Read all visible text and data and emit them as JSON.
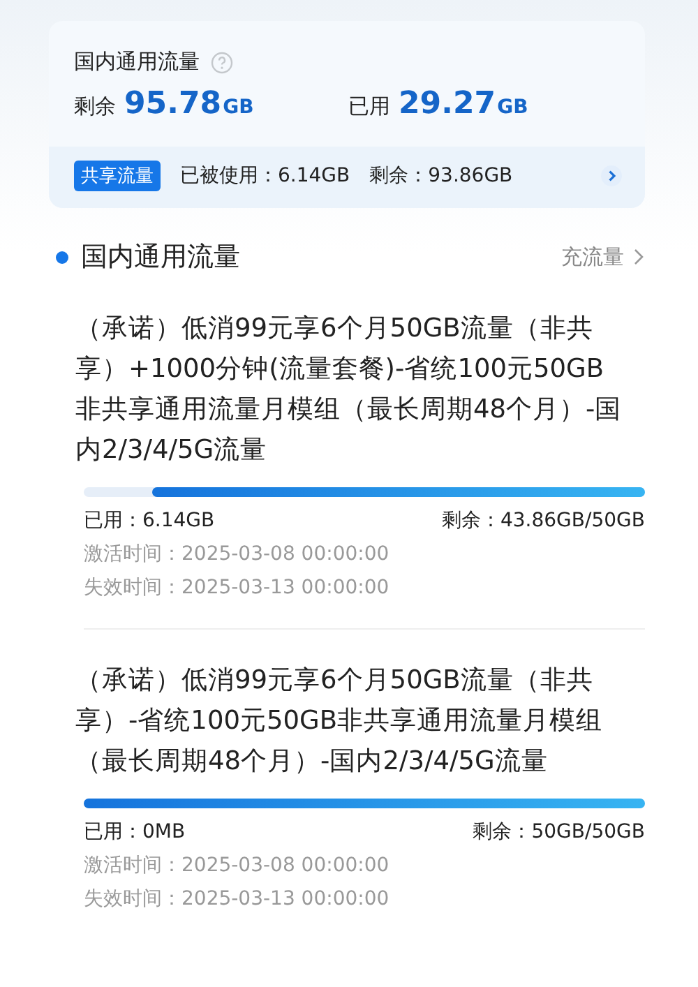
{
  "summary": {
    "title": "国内通用流量",
    "remaining_label": "剩余",
    "remaining_value": "95.78",
    "remaining_unit": "GB",
    "used_label": "已用",
    "used_value": "29.27",
    "used_unit": "GB",
    "shared": {
      "tag": "共享流量",
      "used": "已被使用：6.14GB",
      "remaining": "剩余：93.86GB"
    }
  },
  "section": {
    "title": "国内通用流量",
    "action": "充流量"
  },
  "packages": [
    {
      "name": "（承诺）低消99元享6个月50GB流量（非共享）+1000分钟(流量套餐)-省统100元50GB非共享通用流量月模组（最长周期48个月）-国内2/3/4/5G流量",
      "level": 0.877,
      "used": "已用：6.14GB",
      "remaining": "剩余：43.86GB/50GB",
      "activated": "激活时间：2025-03-08 00:00:00",
      "expires": "失效时间：2025-03-13 00:00:00"
    },
    {
      "name": "（承诺）低消99元享6个月50GB流量（非共享）-省统100元50GB非共享通用流量月模组（最长周期48个月）-国内2/3/4/5G流量",
      "level": 1,
      "used": "已用：0MB",
      "remaining": "剩余：50GB/50GB",
      "activated": "激活时间：2025-03-08 00:00:00",
      "expires": "失效时间：2025-03-13 00:00:00"
    }
  ]
}
